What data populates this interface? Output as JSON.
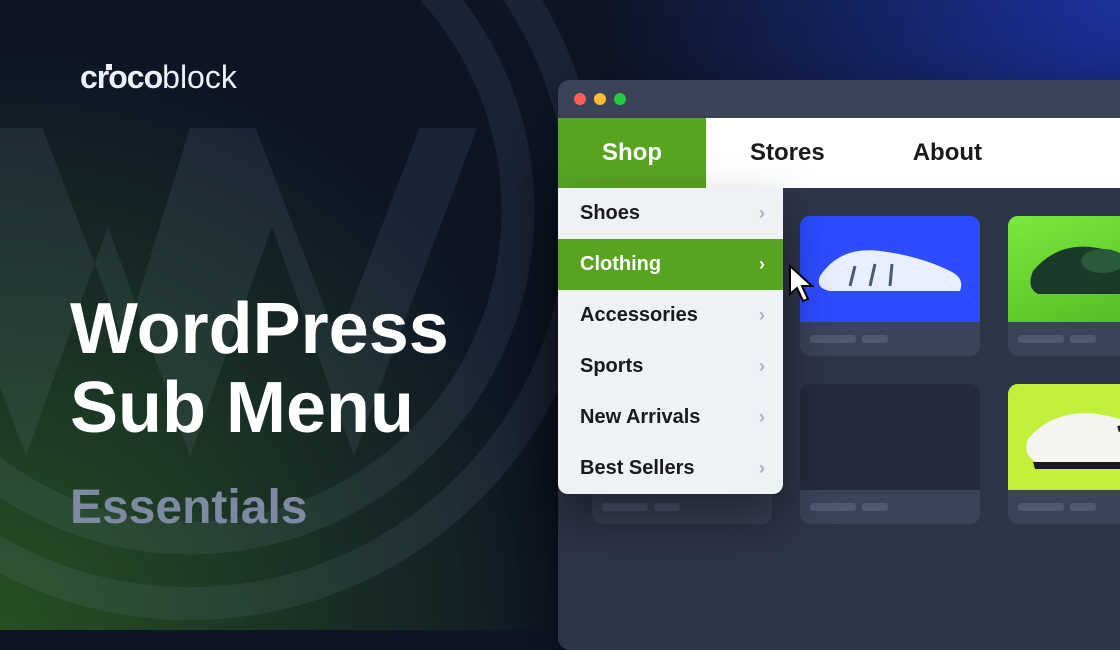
{
  "brand": {
    "name_a": "croco",
    "name_b": "block"
  },
  "headline": {
    "line1": "WordPress",
    "line2": "Sub Menu"
  },
  "subtitle": "Essentials",
  "menubar": {
    "items": [
      {
        "label": "Shop",
        "active": true
      },
      {
        "label": "Stores",
        "active": false
      },
      {
        "label": "About",
        "active": false
      }
    ]
  },
  "dropdown": {
    "items": [
      {
        "label": "Shoes",
        "hover": false
      },
      {
        "label": "Clothing",
        "hover": true
      },
      {
        "label": "Accessories",
        "hover": false
      },
      {
        "label": "Sports",
        "hover": false
      },
      {
        "label": "New Arrivals",
        "hover": false
      },
      {
        "label": "Best Sellers",
        "hover": false
      }
    ]
  },
  "colors": {
    "accent": "#58a421",
    "bg": "#0e1626",
    "card_purple": "#b23ad6",
    "card_blue": "#2d4bff",
    "card_yellow": "#c2ef3a"
  },
  "cards": [
    {
      "img": "purple"
    },
    {
      "img": "shoe-blue"
    },
    {
      "img": "shoe-green"
    },
    {
      "img": "dark"
    },
    {
      "img": "dark"
    },
    {
      "img": "shoe-yellow"
    }
  ]
}
